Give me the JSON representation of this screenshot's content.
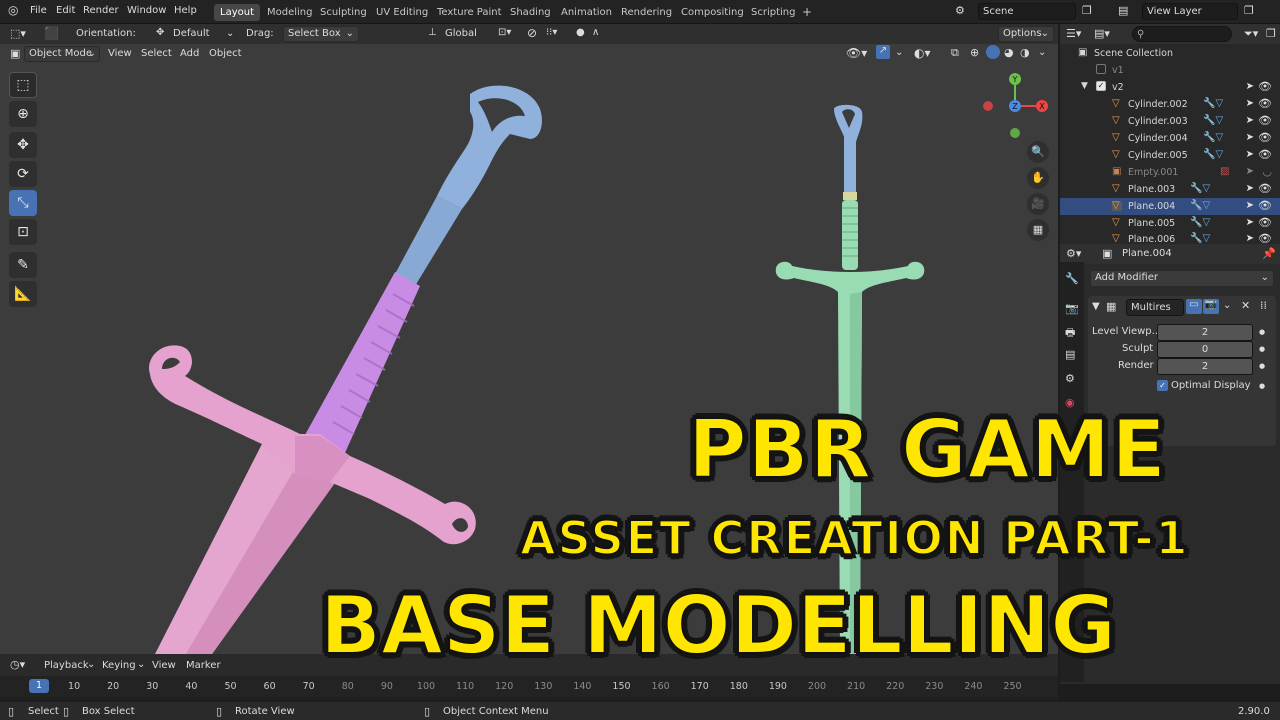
{
  "topbar": {
    "menus": [
      "File",
      "Edit",
      "Render",
      "Window",
      "Help"
    ],
    "workspaces": [
      "Layout",
      "Modeling",
      "Sculpting",
      "UV Editing",
      "Texture Paint",
      "Shading",
      "Animation",
      "Rendering",
      "Compositing",
      "Scripting"
    ],
    "add_tab": "+",
    "scene_name": "Scene",
    "view_layer": "View Layer"
  },
  "viewport_header": {
    "orientation_label": "Orientation:",
    "orientation_value": "Default",
    "drag_label": "Drag:",
    "drag_value": "Select Box",
    "transform_orientation": "Global",
    "options": "Options",
    "mode": "Object Mode",
    "menus": [
      "View",
      "Select",
      "Add",
      "Object"
    ]
  },
  "gizmo": {
    "y": "Y",
    "z": "Z",
    "x": "X"
  },
  "outliner": {
    "search_placeholder": "",
    "root": "Scene Collection",
    "collections": [
      "v1",
      "v2"
    ],
    "objects": [
      {
        "name": "Cylinder.002",
        "type": "mesh"
      },
      {
        "name": "Cylinder.003",
        "type": "mesh"
      },
      {
        "name": "Cylinder.004",
        "type": "mesh"
      },
      {
        "name": "Cylinder.005",
        "type": "mesh"
      },
      {
        "name": "Empty.001",
        "type": "empty"
      },
      {
        "name": "Plane.003",
        "type": "mesh"
      },
      {
        "name": "Plane.004",
        "type": "mesh"
      },
      {
        "name": "Plane.005",
        "type": "mesh"
      },
      {
        "name": "Plane.006",
        "type": "mesh"
      }
    ]
  },
  "properties": {
    "object_name": "Plane.004",
    "add_modifier": "Add Modifier",
    "modifier_name": "Multires",
    "fields": [
      {
        "label": "Level Viewp...",
        "value": "2"
      },
      {
        "label": "Sculpt",
        "value": "0"
      },
      {
        "label": "Render",
        "value": "2"
      }
    ],
    "optimal_display": "Optimal Display"
  },
  "timeline": {
    "menus": [
      "Playback",
      "Keying",
      "View",
      "Marker"
    ],
    "current_frame": "1",
    "ticks": [
      "10",
      "20",
      "30",
      "40",
      "50",
      "60",
      "70",
      "80",
      "90",
      "100",
      "110",
      "120",
      "130",
      "140",
      "150",
      "160",
      "170",
      "180",
      "190",
      "200",
      "210",
      "220",
      "230",
      "240",
      "250"
    ]
  },
  "status": {
    "items": [
      "Select",
      "Box Select",
      "Rotate View",
      "Object Context Menu"
    ],
    "version": "2.90.0"
  },
  "overlay": {
    "line1": "PBR GAME",
    "line2": "ASSET CREATION PART-1",
    "line3": "BASE MODELLING"
  },
  "colors": {
    "accent": "#4772b3",
    "title_yellow": "#ffe600",
    "guard_pink": "#e5a2cf",
    "grip_violet": "#cc8de8",
    "pommel_blue": "#8fb1db",
    "sword2_green": "#99dcb4"
  }
}
